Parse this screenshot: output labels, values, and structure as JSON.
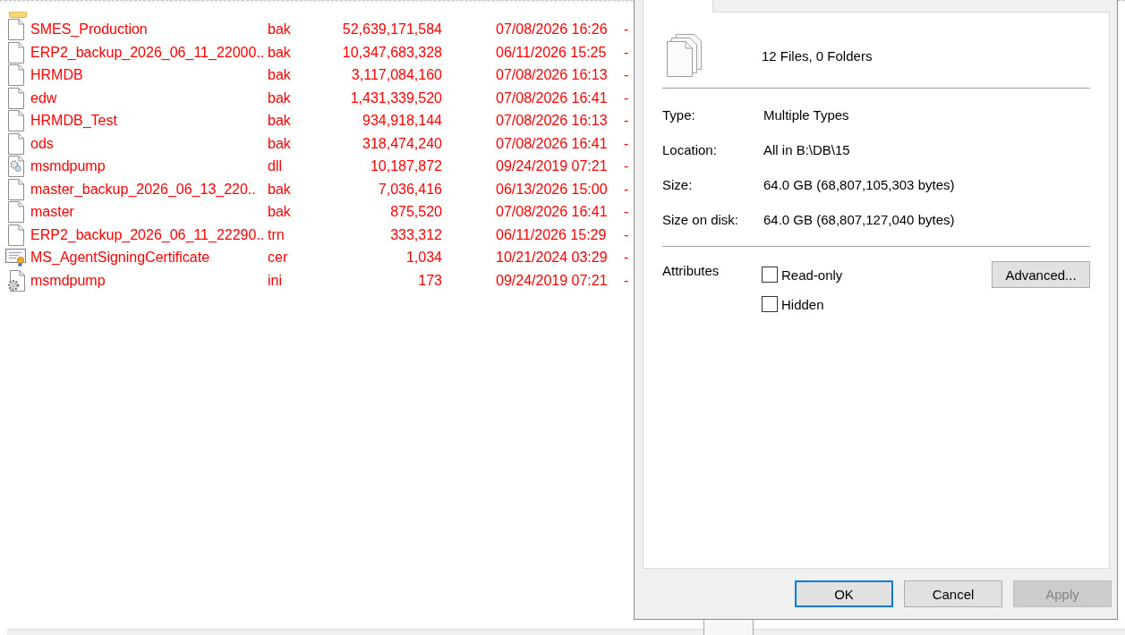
{
  "file_list": {
    "rows": [
      {
        "kind": "document",
        "name": "SMES_Production",
        "type": "bak",
        "size": "52,639,171,584",
        "modified": "07/08/2026 16:26",
        "attributes": "-"
      },
      {
        "kind": "document",
        "name": "ERP2_backup_2026_06_11_22000..",
        "type": "bak",
        "size": "10,347,683,328",
        "modified": "06/11/2026 15:25",
        "attributes": "-"
      },
      {
        "kind": "document",
        "name": "HRMDB",
        "type": "bak",
        "size": "3,117,084,160",
        "modified": "07/08/2026 16:13",
        "attributes": "-"
      },
      {
        "kind": "document",
        "name": "edw",
        "type": "bak",
        "size": "1,431,339,520",
        "modified": "07/08/2026 16:41",
        "attributes": "-"
      },
      {
        "kind": "document",
        "name": "HRMDB_Test",
        "type": "bak",
        "size": "934,918,144",
        "modified": "07/08/2026 16:13",
        "attributes": "-"
      },
      {
        "kind": "document",
        "name": "ods",
        "type": "bak",
        "size": "318,474,240",
        "modified": "07/08/2026 16:41",
        "attributes": "-"
      },
      {
        "kind": "library",
        "name": "msmdpump",
        "type": "dll",
        "size": "10,187,872",
        "modified": "09/24/2019 07:21",
        "attributes": "-"
      },
      {
        "kind": "document",
        "name": "master_backup_2026_06_13_220..",
        "type": "bak",
        "size": "7,036,416",
        "modified": "06/13/2026 15:00",
        "attributes": "-"
      },
      {
        "kind": "document",
        "name": "master",
        "type": "bak",
        "size": "875,520",
        "modified": "07/08/2026 16:41",
        "attributes": "-"
      },
      {
        "kind": "document",
        "name": "ERP2_backup_2026_06_11_22290..",
        "type": "trn",
        "size": "333,312",
        "modified": "06/11/2026 15:29",
        "attributes": "-"
      },
      {
        "kind": "certificate",
        "name": "MS_AgentSigningCertificate",
        "type": "cer",
        "size": "1,034",
        "modified": "10/21/2024 03:29",
        "attributes": "-"
      },
      {
        "kind": "config",
        "name": "msmdpump",
        "type": "ini",
        "size": "173",
        "modified": "09/24/2019 07:21",
        "attributes": "-"
      }
    ]
  },
  "properties_dialog": {
    "summary": "12 Files, 0 Folders",
    "fields": [
      {
        "label": "Type:",
        "value": "Multiple Types"
      },
      {
        "label": "Location:",
        "value": "All in B:\\DB\\15"
      },
      {
        "label": "Size:",
        "value": "64.0 GB (68,807,105,303 bytes)"
      },
      {
        "label": "Size on disk:",
        "value": "64.0 GB (68,807,127,040 bytes)"
      }
    ],
    "attributes": {
      "label": "Attributes",
      "options": [
        {
          "label": "Read-only",
          "checked": false
        },
        {
          "label": "Hidden",
          "checked": false
        }
      ],
      "advanced_button": "Advanced..."
    },
    "buttons": [
      {
        "label": "OK",
        "default": true,
        "disabled": false
      },
      {
        "label": "Cancel",
        "default": false,
        "disabled": false
      },
      {
        "label": "Apply",
        "default": false,
        "disabled": true
      }
    ]
  }
}
